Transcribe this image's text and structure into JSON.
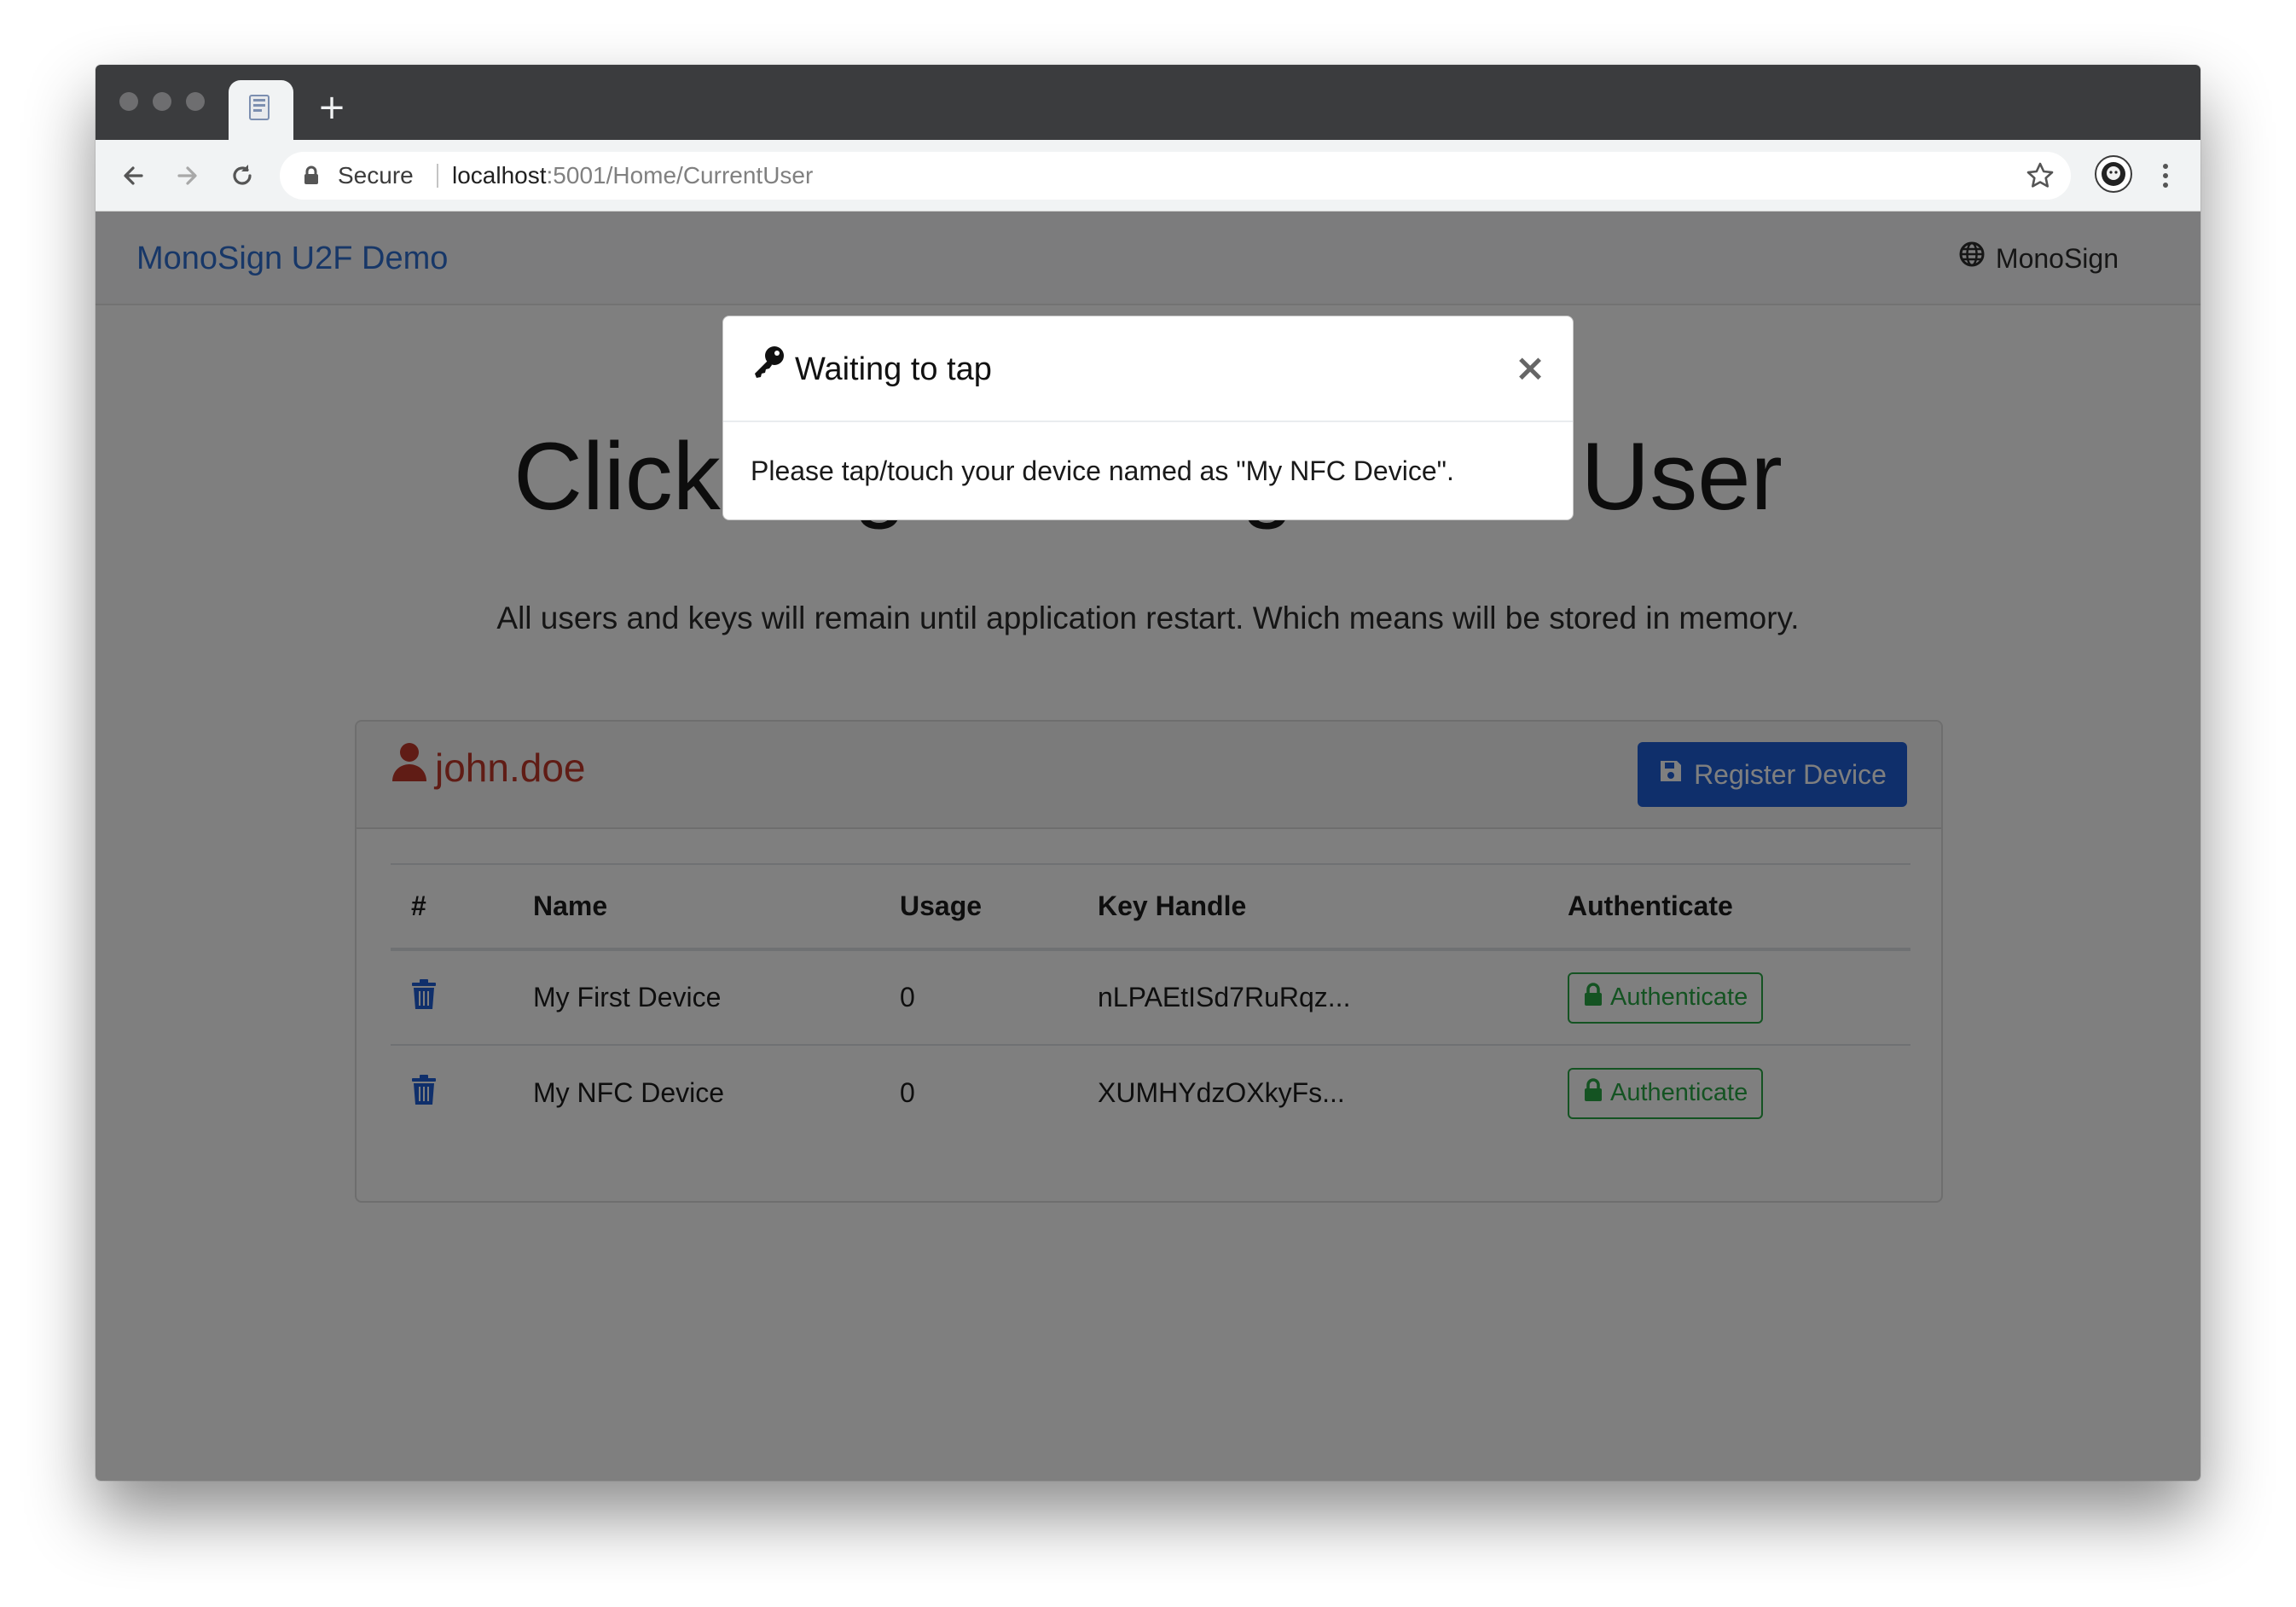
{
  "browser": {
    "secure_label": "Secure",
    "url_host": "localhost",
    "url_path": ":5001/Home/CurrentUser",
    "icons": [
      "back-arrow-icon",
      "forward-arrow-icon",
      "reload-icon",
      "lock-icon",
      "star-icon",
      "profile-icon",
      "more-vert-icon",
      "new-tab-plus-icon",
      "page-icon"
    ]
  },
  "navbar": {
    "brand": "MonoSign U2F Demo",
    "right_link": "MonoSign",
    "right_icon": "globe-icon",
    "brand_color": "#2f6fd1"
  },
  "jumbotron": {
    "title": "Click Login or Register a User",
    "subtitle": "All users and keys will remain until application restart. Which means will be stored in memory."
  },
  "card": {
    "user_name": "john.doe",
    "user_icon": "user-icon",
    "user_color": "#c0392b",
    "register_label": "Register Device",
    "register_icon": "save-icon",
    "register_color": "#1f5fd6"
  },
  "table": {
    "headers": [
      "#",
      "Name",
      "Usage",
      "Key Handle",
      "Authenticate"
    ],
    "rows": [
      {
        "name": "My First Device",
        "usage": "0",
        "key_handle": "nLPAEtISd7RuRqz...",
        "auth_label": "Authenticate"
      },
      {
        "name": "My NFC Device",
        "usage": "0",
        "key_handle": "XUMHYdzOXkyFs...",
        "auth_label": "Authenticate"
      }
    ],
    "auth_color": "#28a745"
  },
  "modal": {
    "title": "Waiting to tap",
    "title_icon": "key-icon",
    "close": "×",
    "body": "Please tap/touch your device named as \"My NFC Device\"."
  }
}
